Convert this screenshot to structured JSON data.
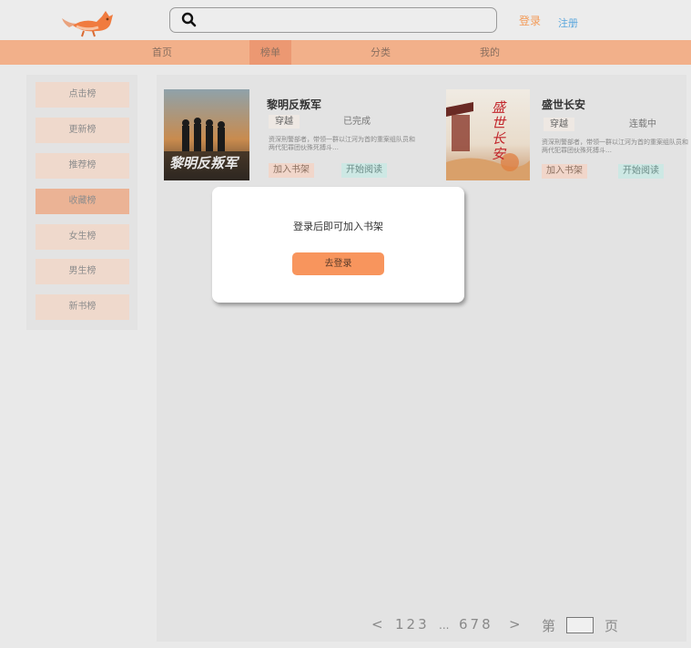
{
  "header": {
    "search": {
      "value": "",
      "placeholder": "",
      "icon": "search-icon"
    },
    "login_label": "登录",
    "register_label": "注册"
  },
  "nav": {
    "items": [
      {
        "label": "首页"
      },
      {
        "label": "榜单"
      },
      {
        "label": "分类"
      },
      {
        "label": "我的"
      }
    ],
    "active": "榜单"
  },
  "sidebar": {
    "items": [
      {
        "label": "点击榜"
      },
      {
        "label": "更新榜"
      },
      {
        "label": "推荐榜"
      },
      {
        "label": "收藏榜"
      },
      {
        "label": "女生榜"
      },
      {
        "label": "男生榜"
      },
      {
        "label": "新书榜"
      }
    ],
    "active": "收藏榜"
  },
  "books": [
    {
      "title": "黎明反叛军",
      "genre": "穿越",
      "status": "已完成",
      "desc": "资深刑警部者，带领一群以江河为首的重案组队员和两代犯罪团伙殊死搏斗…",
      "add_label": "加入书架",
      "read_label": "开始阅读",
      "cover_text": "黎明反叛军"
    },
    {
      "title": "盛世长安",
      "genre": "穿越",
      "status": "连载中",
      "desc": "资深刑警部者，带领一群以江河为首的重案组队员和两代犯罪团伙殊死搏斗…",
      "add_label": "加入书架",
      "read_label": "开始阅读",
      "cover_text": "盛世长安"
    }
  ],
  "pagination": {
    "prev": "<",
    "pages_start": "123",
    "ellipsis": "...",
    "pages_end": "678",
    "next": ">",
    "page_prefix": "第",
    "page_suffix": "页",
    "page_input": ""
  },
  "modal": {
    "message": "登录后即可加入书架",
    "button_label": "去登录"
  },
  "colors": {
    "accent": "#f8955d",
    "nav_bg": "#f2b08a",
    "nav_active": "#ec9872",
    "login_link": "#f39a57",
    "register_link": "#5ba7dd"
  }
}
